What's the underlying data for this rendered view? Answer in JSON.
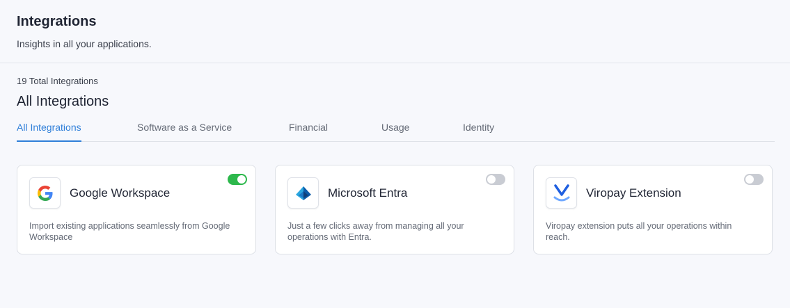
{
  "header": {
    "title": "Integrations",
    "subtitle": "Insights in all your applications."
  },
  "summary": {
    "count_label": "19 Total Integrations",
    "section_title": "All Integrations"
  },
  "tabs": [
    {
      "label": "All Integrations",
      "active": true
    },
    {
      "label": "Software as a Service",
      "active": false
    },
    {
      "label": "Financial",
      "active": false
    },
    {
      "label": "Usage",
      "active": false
    },
    {
      "label": "Identity",
      "active": false
    }
  ],
  "integrations": [
    {
      "name": "Google Workspace",
      "description": "Import existing applications seamlessly from Google Workspace",
      "enabled": true,
      "icon": "google-logo-icon"
    },
    {
      "name": "Microsoft Entra",
      "description": "Just a few clicks away from managing all your operations with Entra.",
      "enabled": false,
      "icon": "microsoft-entra-logo-icon"
    },
    {
      "name": "Viropay Extension",
      "description": "Viropay extension puts all your operations within reach.",
      "enabled": false,
      "icon": "viropay-logo-icon"
    }
  ],
  "colors": {
    "accent": "#2f7fd9",
    "toggle_on": "#2db84c",
    "toggle_off": "#c9ccd3"
  }
}
